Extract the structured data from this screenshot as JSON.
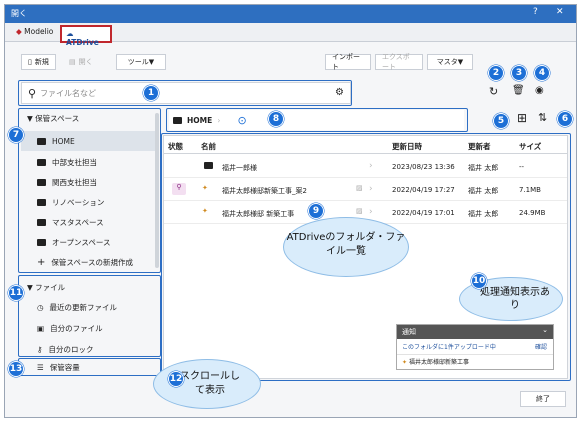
{
  "window": {
    "title": "開く",
    "help": "?",
    "close": "✕"
  },
  "tabs": [
    {
      "label": "Modelio"
    },
    {
      "label": "ATDrive"
    }
  ],
  "toolbar": {
    "new": "新規",
    "open": "開く",
    "tools": "ツール▼",
    "import": "インポート",
    "export": "エクスポート",
    "master": "マスタ▼"
  },
  "search": {
    "placeholder": "ファイル名など"
  },
  "sidebar": {
    "storage_header": "▼ 保管スペース",
    "items": [
      "HOME",
      "中部支社担当",
      "関西支社担当",
      "リノベーション",
      "マスタスペース",
      "オープンスペース"
    ],
    "new_space": "保管スペースの新規作成",
    "file_header": "▼ ファイル",
    "file_items": [
      "最近の更新ファイル",
      "自分のファイル",
      "自分のロック"
    ],
    "capacity": "保管容量"
  },
  "breadcrumb": {
    "home": "HOME"
  },
  "table": {
    "headers": [
      "状態",
      "名前",
      "更新日時",
      "更新者",
      "サイズ"
    ],
    "rows": [
      {
        "name": "福井一郎様",
        "date": "2023/08/23 13:36",
        "user": "福井 太郎",
        "size": "--"
      },
      {
        "name": "福井太郎様邸新築工事_案2",
        "date": "2022/04/19 17:27",
        "user": "福井 太郎",
        "size": "7.1MB"
      },
      {
        "name": "福井太郎様邸 新築工事",
        "date": "2022/04/19 17:01",
        "user": "福井 太郎",
        "size": "24.9MB"
      }
    ]
  },
  "notification": {
    "title": "通知",
    "message": "このフォルダに1件アップロード中",
    "confirm": "確認",
    "file": "福井太郎様邸新築工事"
  },
  "callouts": [
    "1",
    "2",
    "3",
    "4",
    "5",
    "6",
    "7",
    "8",
    "9",
    "10",
    "11",
    "12",
    "13"
  ],
  "bubbles": {
    "b9": "ATDriveのフォルダ・ファイル一覧",
    "b10": "処理通知表示あり",
    "b12": "スクロールして表示"
  },
  "footer": {
    "close": "終了"
  },
  "colors": {
    "titlebar": "#2e6fc0",
    "callout": "#1d6fd6",
    "tab_highlight": "#c0272d"
  }
}
